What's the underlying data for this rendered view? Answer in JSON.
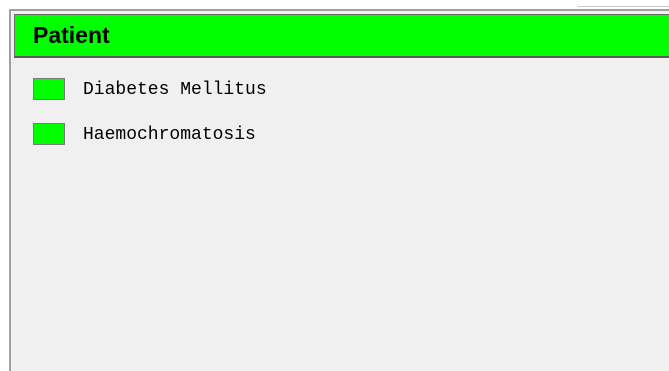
{
  "panel": {
    "title": "Patient",
    "header_color": "#00ff00",
    "conditions": [
      {
        "label": "Diabetes Mellitus",
        "status_color": "#00ff00"
      },
      {
        "label": "Haemochromatosis",
        "status_color": "#00ff00"
      }
    ]
  }
}
